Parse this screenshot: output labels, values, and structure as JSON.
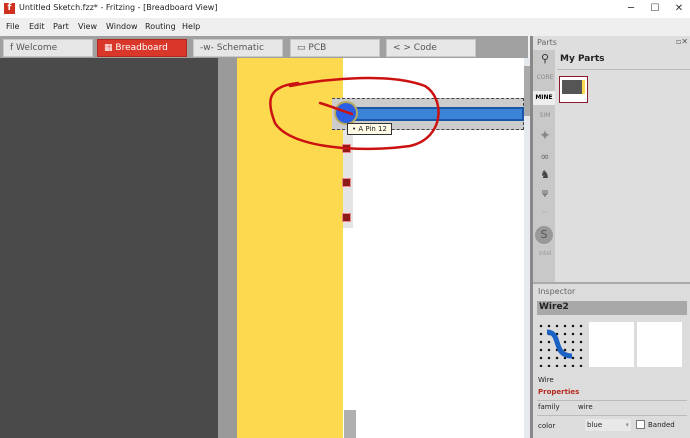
{
  "window": {
    "title": "Untitled Sketch.fzz* - Fritzing - [Breadboard View]",
    "logo": "f",
    "controls": [
      "─",
      "☐",
      "✕"
    ]
  },
  "menu": [
    "File",
    "Edit",
    "Part",
    "View",
    "Window",
    "Routing",
    "Help"
  ],
  "tabs": [
    {
      "label": "Welcome",
      "icon": "f"
    },
    {
      "label": "Breadboard",
      "icon": "▦"
    },
    {
      "label": "Schematic",
      "icon": "-w-"
    },
    {
      "label": "PCB",
      "icon": "▭"
    },
    {
      "label": "< > Code",
      "icon": ""
    }
  ],
  "canvas": {
    "tooltip": "• A Pin 12",
    "wire_color": "#3b83d6",
    "annotation_color": "#cc1111"
  },
  "parts": {
    "header": "Parts",
    "section": "My Parts",
    "bins": [
      "CORE",
      "MINE",
      "SIM"
    ],
    "search_icon": "search-icon"
  },
  "inspector": {
    "header": "Inspector",
    "name": "Wire2",
    "type": "Wire",
    "properties_label": "Properties",
    "family_label": "family",
    "family_value": "wire",
    "color_label": "color",
    "color_value": "blue",
    "banded_label": "Banded",
    "banded": false
  }
}
